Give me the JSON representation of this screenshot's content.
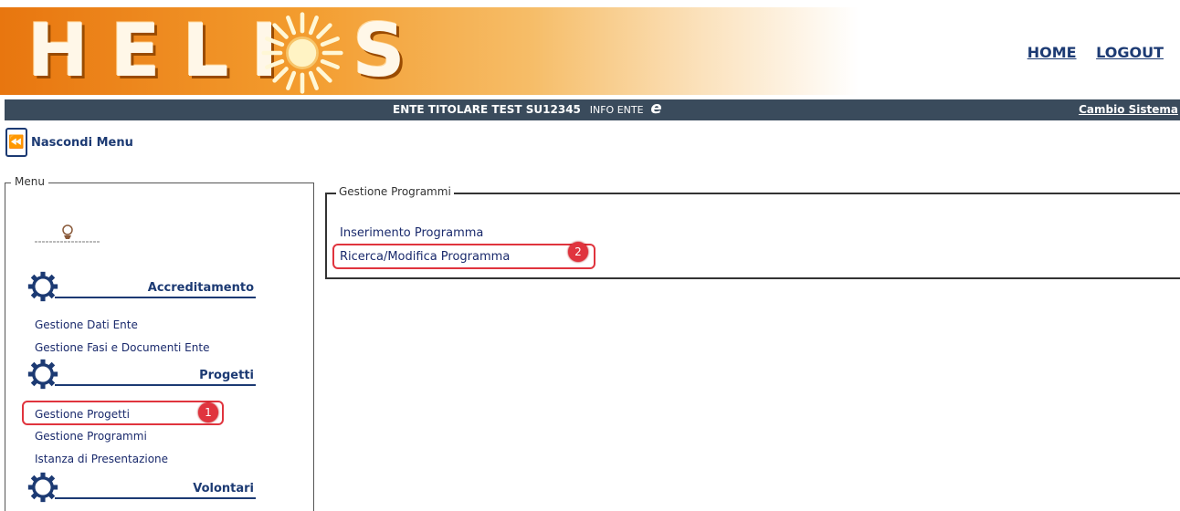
{
  "header": {
    "logo_main": "HELI",
    "logo_end": "S",
    "home_label": "HOME",
    "logout_label": "LOGOUT"
  },
  "ente_bar": {
    "ente_name": "ENTE TITOLARE TEST  SU12345",
    "info_label": "INFO ENTE",
    "ie_icon": "e",
    "cambio_label": "Cambio Sistema"
  },
  "hide_menu": {
    "icon": "⏪",
    "label": "Nascondi Menu"
  },
  "menu": {
    "legend": "Menu",
    "sections": [
      {
        "title": "Accreditamento",
        "items": [
          "Gestione Dati Ente",
          "Gestione Fasi e Documenti Ente"
        ]
      },
      {
        "title": "Progetti",
        "items": [
          "Gestione Progetti",
          "Gestione Programmi",
          "Istanza di Presentazione"
        ]
      },
      {
        "title": "Volontari",
        "items": []
      }
    ]
  },
  "programmi": {
    "legend": "Gestione Programmi",
    "links": [
      "Inserimento Programma",
      "Ricerca/Modifica Programma"
    ]
  },
  "annotations": {
    "badge_1": "1",
    "badge_2": "2"
  },
  "colors": {
    "navy": "#1c3a73",
    "bar": "#3a4b5c",
    "highlight": "#e0343e",
    "orange": "#f39c2e"
  }
}
